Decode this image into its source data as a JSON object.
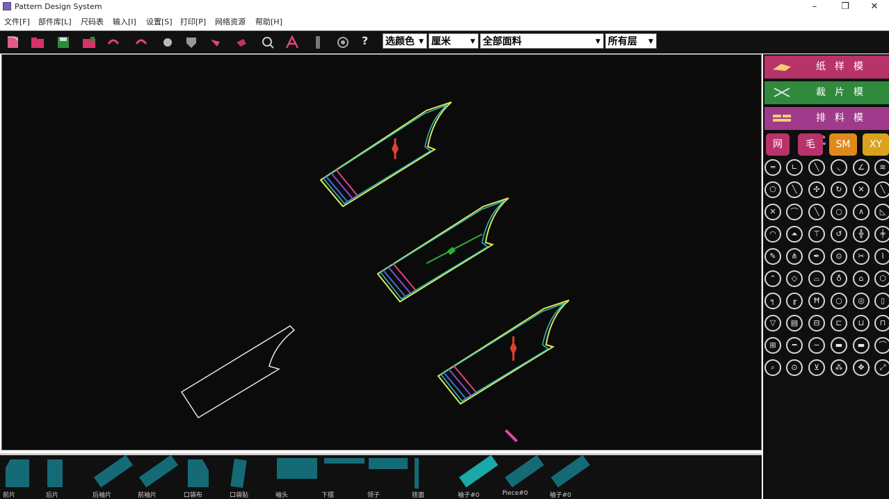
{
  "window": {
    "title": "Pattern Design System",
    "minimize": "–",
    "maximize": "❐",
    "close": "✕"
  },
  "menu": [
    "文件[F]",
    "部件库[L]",
    "尺码表",
    "输入[I]",
    "设置[S]",
    "打印[P]",
    "网络资源",
    "帮助[H]"
  ],
  "toolbar": {
    "help": "?",
    "selects": [
      {
        "value": "选颜色"
      },
      {
        "value": "厘米"
      },
      {
        "value": "全部面料"
      },
      {
        "value": "所有层"
      }
    ]
  },
  "modes": [
    {
      "label": "纸样模式",
      "color": "#b8336a"
    },
    {
      "label": "裁片模式",
      "color": "#2f8a3c"
    },
    {
      "label": "排料模式",
      "color": "#a03a8a"
    }
  ],
  "tags": [
    {
      "label": "网",
      "color": "#b8336a"
    },
    {
      "label": "毛",
      "color": "#b8336a"
    },
    {
      "label": "SM",
      "color": "#e08a1c"
    },
    {
      "label": "XY",
      "color": "#d8a21c"
    }
  ],
  "pieces": [
    {
      "label": "前片"
    },
    {
      "label": "后片"
    },
    {
      "label": "后袖片"
    },
    {
      "label": "前袖片"
    },
    {
      "label": "口袋布"
    },
    {
      "label": "口袋贴"
    },
    {
      "label": "袖头"
    },
    {
      "label": "下摆"
    },
    {
      "label": "领子"
    },
    {
      "label": "挂面"
    },
    {
      "label": "袖子#0"
    },
    {
      "label": "Piece#0"
    },
    {
      "label": "袖子#0"
    }
  ]
}
